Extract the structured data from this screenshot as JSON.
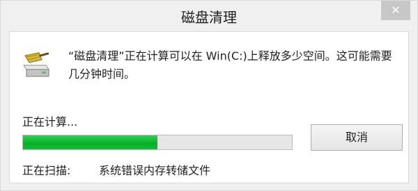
{
  "window": {
    "title": "磁盘清理",
    "close_glyph": "✕"
  },
  "dialog": {
    "icon": "disk-cleanup-icon",
    "message": "“磁盘清理”正在计算可以在 Win(C:)上释放多少空间。这可能需要几分钟时间。",
    "status_label": "正在计算...",
    "progress": 0.5,
    "scan_label": "正在扫描:",
    "scan_value": "系统错误内存转储文件",
    "cancel_label": "取消"
  },
  "colors": {
    "progress_fill": "#06b025",
    "close_button_bg": "#c7c7c7"
  }
}
